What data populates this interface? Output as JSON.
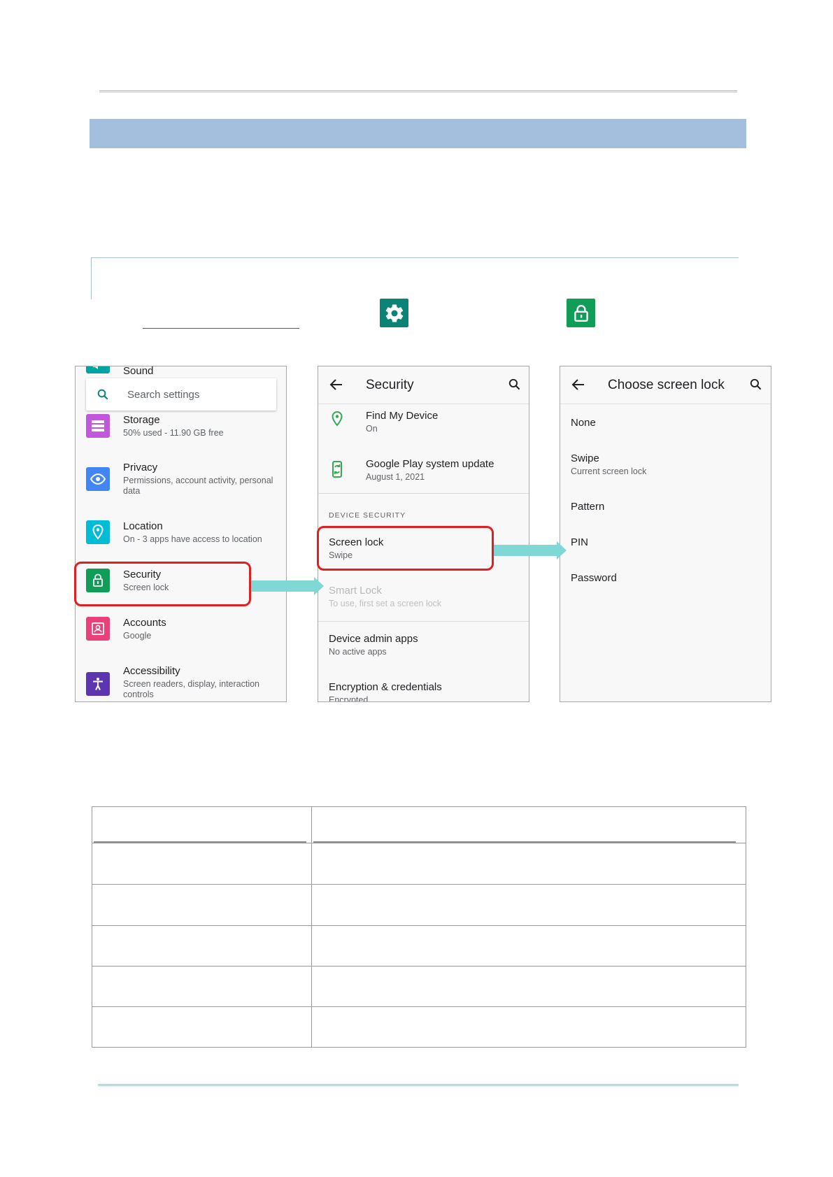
{
  "panel1": {
    "partial_item": "Sound",
    "search_placeholder": "Search settings",
    "items": [
      {
        "title": "Storage",
        "subtitle": "50% used - 11.90 GB free",
        "icon": "storage-icon",
        "color": "#c158dc"
      },
      {
        "title": "Privacy",
        "subtitle": "Permissions, account activity, personal data",
        "icon": "privacy-eye-icon",
        "color": "#4285f4"
      },
      {
        "title": "Location",
        "subtitle": "On - 3 apps have access to location",
        "icon": "location-pin-icon",
        "color": "#00bcd4"
      },
      {
        "title": "Security",
        "subtitle": "Screen lock",
        "icon": "lock-icon",
        "color": "#0f9d58"
      },
      {
        "title": "Accounts",
        "subtitle": "Google",
        "icon": "account-box-icon",
        "color": "#ec407a"
      },
      {
        "title": "Accessibility",
        "subtitle": "Screen readers, display, interaction controls",
        "icon": "accessibility-icon",
        "color": "#5e35b1"
      }
    ]
  },
  "panel2": {
    "title": "Security",
    "items": [
      {
        "title": "Find My Device",
        "subtitle": "On"
      },
      {
        "title": "Google Play system update",
        "subtitle": "August 1, 2021"
      }
    ],
    "section_header": "DEVICE SECURITY",
    "security_items": [
      {
        "title": "Screen lock",
        "subtitle": "Swipe"
      },
      {
        "title": "Smart Lock",
        "subtitle": "To use, first set a screen lock"
      },
      {
        "title": "Device admin apps",
        "subtitle": "No active apps"
      },
      {
        "title": "Encryption & credentials",
        "subtitle": "Encrypted"
      }
    ]
  },
  "panel3": {
    "title": "Choose screen lock",
    "options": [
      {
        "title": "None",
        "subtitle": ""
      },
      {
        "title": "Swipe",
        "subtitle": "Current screen lock"
      },
      {
        "title": "Pattern",
        "subtitle": ""
      },
      {
        "title": "PIN",
        "subtitle": ""
      },
      {
        "title": "Password",
        "subtitle": ""
      }
    ]
  },
  "colors": {
    "banner": "#a4bfdd",
    "settings_app": "#0b8477",
    "lock_app": "#0f9d58",
    "highlight": "#e02020",
    "arrow": "#7fd7d6"
  }
}
